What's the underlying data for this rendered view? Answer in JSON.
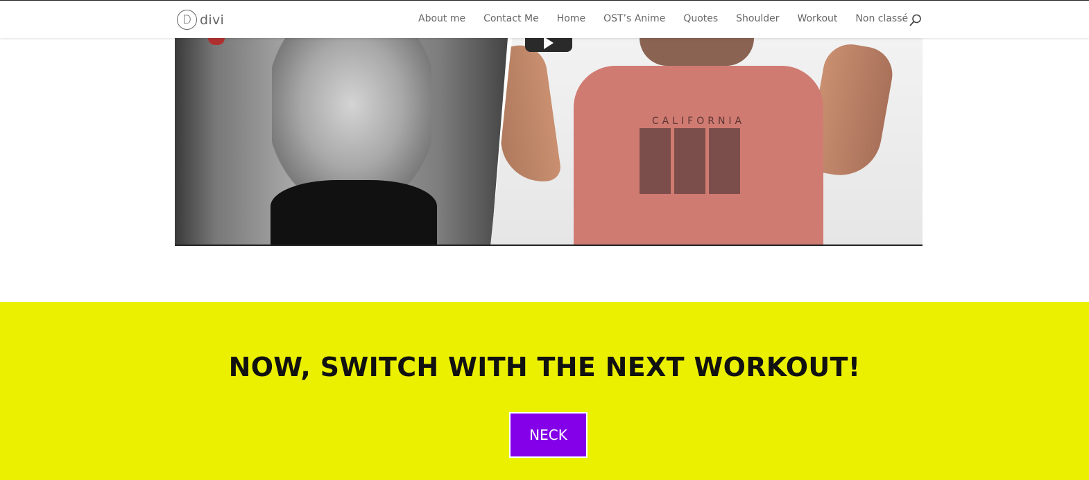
{
  "header": {
    "logo_letter": "D",
    "logo_text": "divi",
    "nav": [
      "About me",
      "Contact Me",
      "Home",
      "OST’s Anime",
      "Quotes",
      "Shoulder",
      "Workout",
      "Non classé"
    ],
    "search_icon": "search-icon"
  },
  "video": {
    "shirt_text": "CALIFORNIA",
    "play_icon": "play-icon"
  },
  "cta": {
    "title": "NOW, SWITCH WITH THE NEXT WORKOUT!",
    "button_label": "NECK",
    "background_color": "#ebf000",
    "button_color": "#8300e9"
  }
}
